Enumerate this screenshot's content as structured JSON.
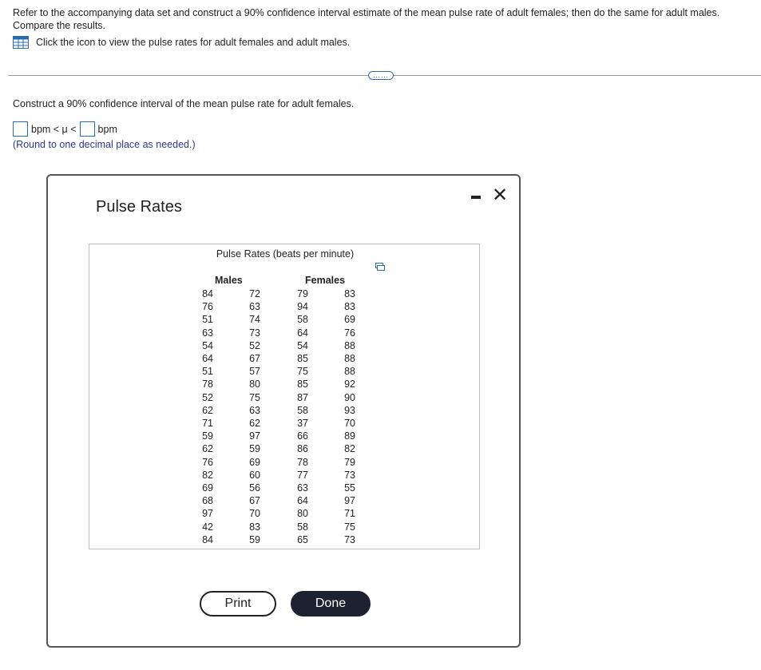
{
  "intro": {
    "text1": "Refer to the accompanying data set and construct a 90% confidence interval estimate of the mean pulse rate of adult females; then do the same for adult males. Compare the results.",
    "text2": "Click the icon to view the pulse rates for adult females and adult males."
  },
  "more_label": "……",
  "question": "Construct a 90% confidence interval of the mean pulse rate for adult females.",
  "answer": {
    "lower_value": "",
    "unit1": "bpm < μ <",
    "upper_value": "",
    "unit2": "bpm"
  },
  "round_note": "(Round to one decimal place as needed.)",
  "dialog": {
    "title": "Pulse Rates",
    "table_title": "Pulse Rates (beats per minute)",
    "males_label": "Males",
    "females_label": "Females",
    "males_col1": [
      84,
      76,
      51,
      63,
      54,
      64,
      51,
      78,
      52,
      62,
      71,
      59,
      62,
      76,
      82,
      69,
      68,
      97,
      42,
      84
    ],
    "males_col2": [
      72,
      63,
      74,
      73,
      52,
      67,
      57,
      80,
      75,
      63,
      62,
      97,
      59,
      69,
      60,
      56,
      67,
      70,
      83,
      59
    ],
    "females_col1": [
      79,
      94,
      58,
      64,
      54,
      85,
      75,
      85,
      87,
      58,
      37,
      66,
      86,
      78,
      77,
      63,
      64,
      80,
      58,
      65
    ],
    "females_col2": [
      83,
      83,
      69,
      76,
      88,
      88,
      88,
      92,
      90,
      93,
      70,
      89,
      82,
      79,
      73,
      55,
      97,
      71,
      75,
      73
    ],
    "print_label": "Print",
    "done_label": "Done"
  }
}
